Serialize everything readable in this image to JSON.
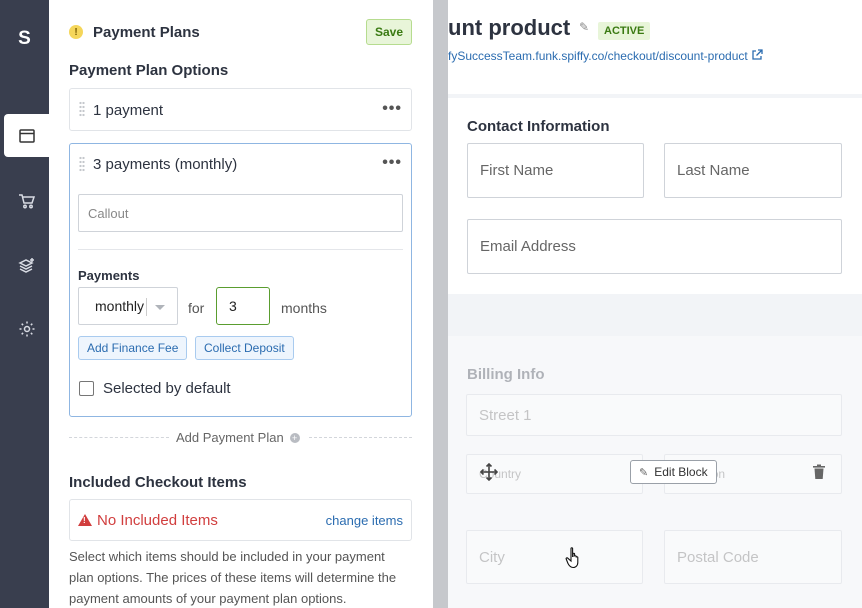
{
  "app": {
    "logo_letter": "S"
  },
  "nav": [
    {
      "name": "checkout-icon",
      "active": true
    },
    {
      "name": "cart-icon",
      "active": false
    },
    {
      "name": "stack-plus-icon",
      "active": false
    },
    {
      "name": "gear-icon",
      "active": false
    }
  ],
  "panel": {
    "title": "Payment Plans",
    "save_label": "Save",
    "options_title": "Payment Plan Options",
    "plans": [
      {
        "label": "1 payment",
        "menu": "•••"
      },
      {
        "label": "3 payments (monthly)",
        "menu": "•••"
      }
    ],
    "editor": {
      "callout_placeholder": "Callout",
      "payments_label": "Payments",
      "frequency_value": "monthly",
      "for_label": "for",
      "count_value": "3",
      "months_label": "months",
      "add_fee_label": "Add Finance Fee",
      "collect_deposit_label": "Collect Deposit",
      "selected_default_label": "Selected by default"
    },
    "add_plan_label": "Add Payment Plan",
    "included_title": "Included Checkout Items",
    "no_items_label": "No Included Items",
    "change_items_label": "change items",
    "help_text": "Select which items should be included in your payment plan options. The prices of these items will determine the payment amounts of your payment plan options."
  },
  "preview": {
    "title": "unt product",
    "status": "ACTIVE",
    "url": "fySuccessTeam.funk.spiffy.co/checkout/discount-product",
    "contact_title": "Contact Information",
    "first_name_placeholder": "First Name",
    "last_name_placeholder": "Last Name",
    "email_placeholder": "Email Address",
    "billing_title": "Billing Info",
    "street_placeholder": "Street 1",
    "country_placeholder": "Country",
    "region_placeholder": "e/Region",
    "city_placeholder": "City",
    "postal_placeholder": "Postal Code",
    "edit_block_label": "Edit Block"
  },
  "colors": {
    "rail": "#393e4e",
    "accent_blue": "#2b6cb0",
    "save_green": "#3a7a12",
    "error_red": "#d13e3e"
  }
}
